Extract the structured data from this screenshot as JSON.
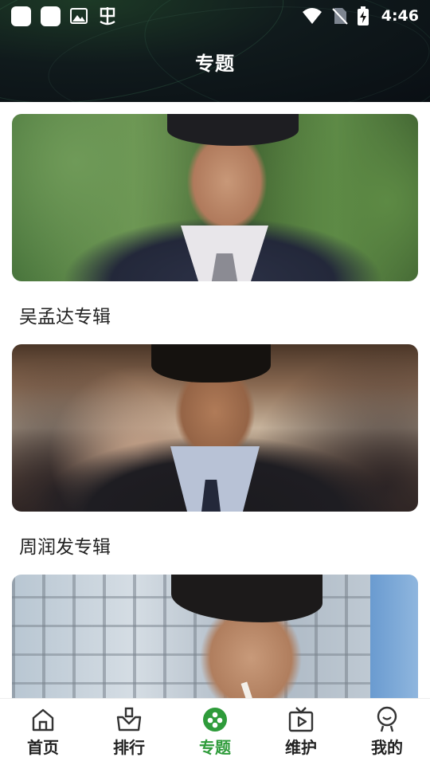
{
  "status_bar": {
    "time": "4:46",
    "left_icons": [
      "notification-square-icon",
      "notification-square-icon",
      "image-icon",
      "bug-icon"
    ],
    "right_icons": [
      "wifi-icon",
      "no-sim-icon",
      "battery-charging-icon"
    ]
  },
  "header": {
    "title": "专题"
  },
  "topics": [
    {
      "title": "吴孟达专辑",
      "image": "man-in-suit-outdoor-photo"
    },
    {
      "title": "周润发专辑",
      "image": "man-in-suit-indoor-photo"
    },
    {
      "title": "",
      "image": "man-with-cigarette-photo"
    }
  ],
  "bottom_nav": {
    "items": [
      {
        "label": "首页",
        "icon": "home-icon"
      },
      {
        "label": "排行",
        "icon": "ranking-icon"
      },
      {
        "label": "专题",
        "icon": "topics-icon",
        "active": true
      },
      {
        "label": "维护",
        "icon": "tv-icon"
      },
      {
        "label": "我的",
        "icon": "profile-icon"
      }
    ]
  },
  "colors": {
    "accent": "#2e9b3a",
    "header_bg": "#0f171a",
    "text": "#222222"
  }
}
